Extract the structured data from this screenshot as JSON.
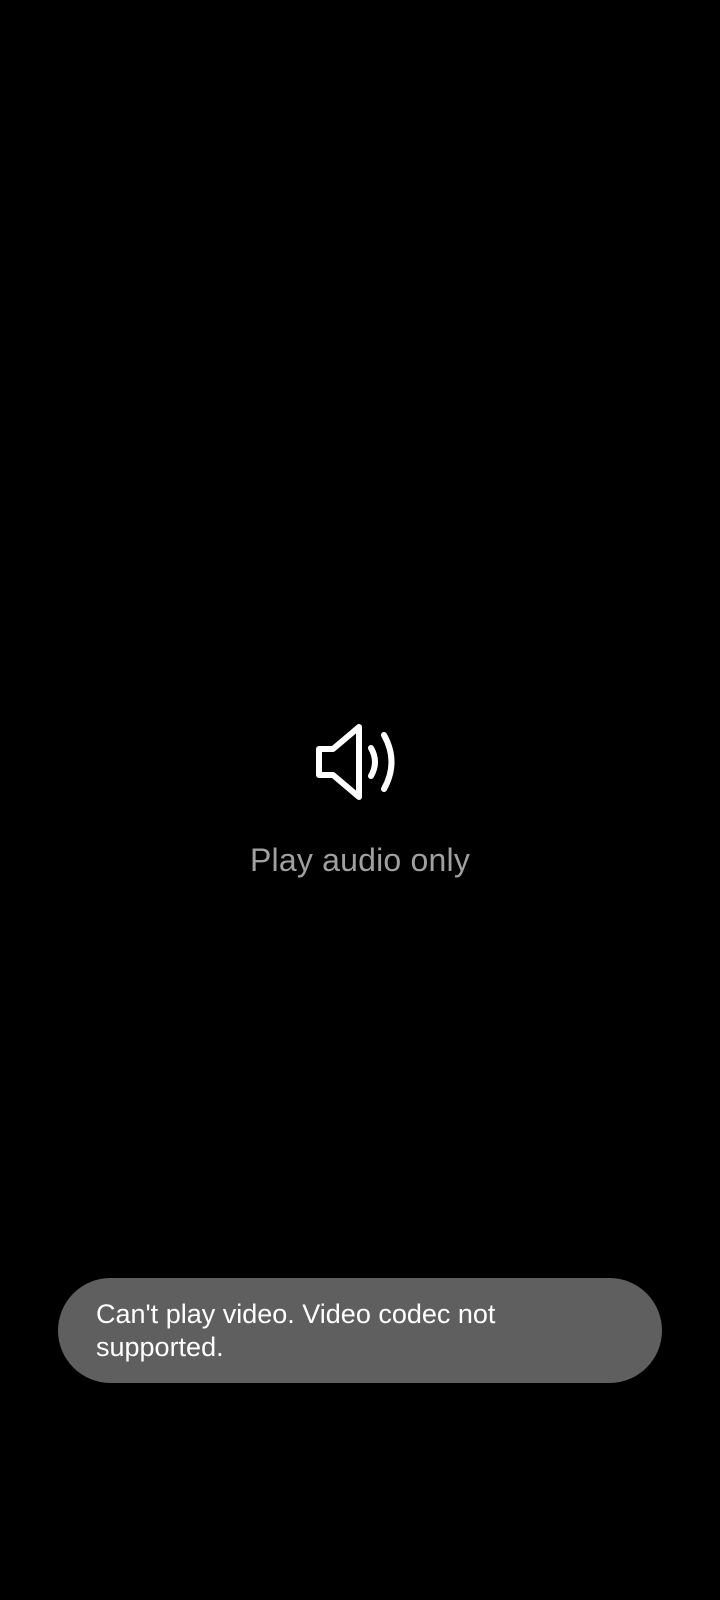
{
  "player": {
    "audio_only": {
      "icon": "speaker-volume-icon",
      "label": "Play audio only"
    }
  },
  "toast": {
    "message": "Can't play video. Video codec not supported."
  },
  "colors": {
    "background": "#000000",
    "label": "#a0a0a0",
    "toast_background": "#5f5f5f",
    "toast_text": "#ffffff"
  }
}
